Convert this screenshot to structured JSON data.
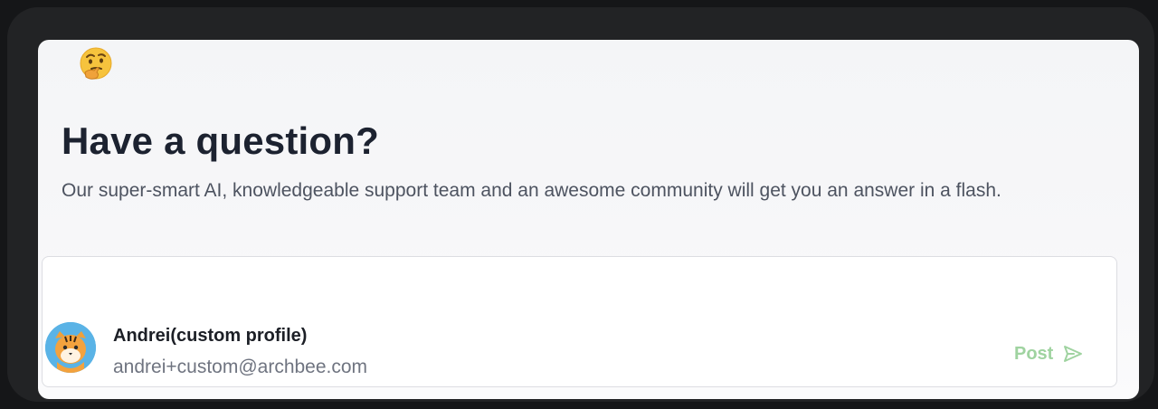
{
  "header": {
    "emoji_icon": "thinking-face-icon",
    "title": "Have a question?",
    "subtitle": "Our super-smart AI, knowledgeable support team and an awesome community will get you an answer in a flash."
  },
  "composer": {
    "user": {
      "name": "Andrei(custom profile)",
      "email": "andrei+custom@archbee.com",
      "avatar_icon": "tiger-avatar-icon"
    },
    "post_label": "Post",
    "post_icon": "send-icon"
  },
  "colors": {
    "title": "#1c2230",
    "post_disabled": "#9fd3a0",
    "avatar_bg": "#5ab3e6"
  }
}
